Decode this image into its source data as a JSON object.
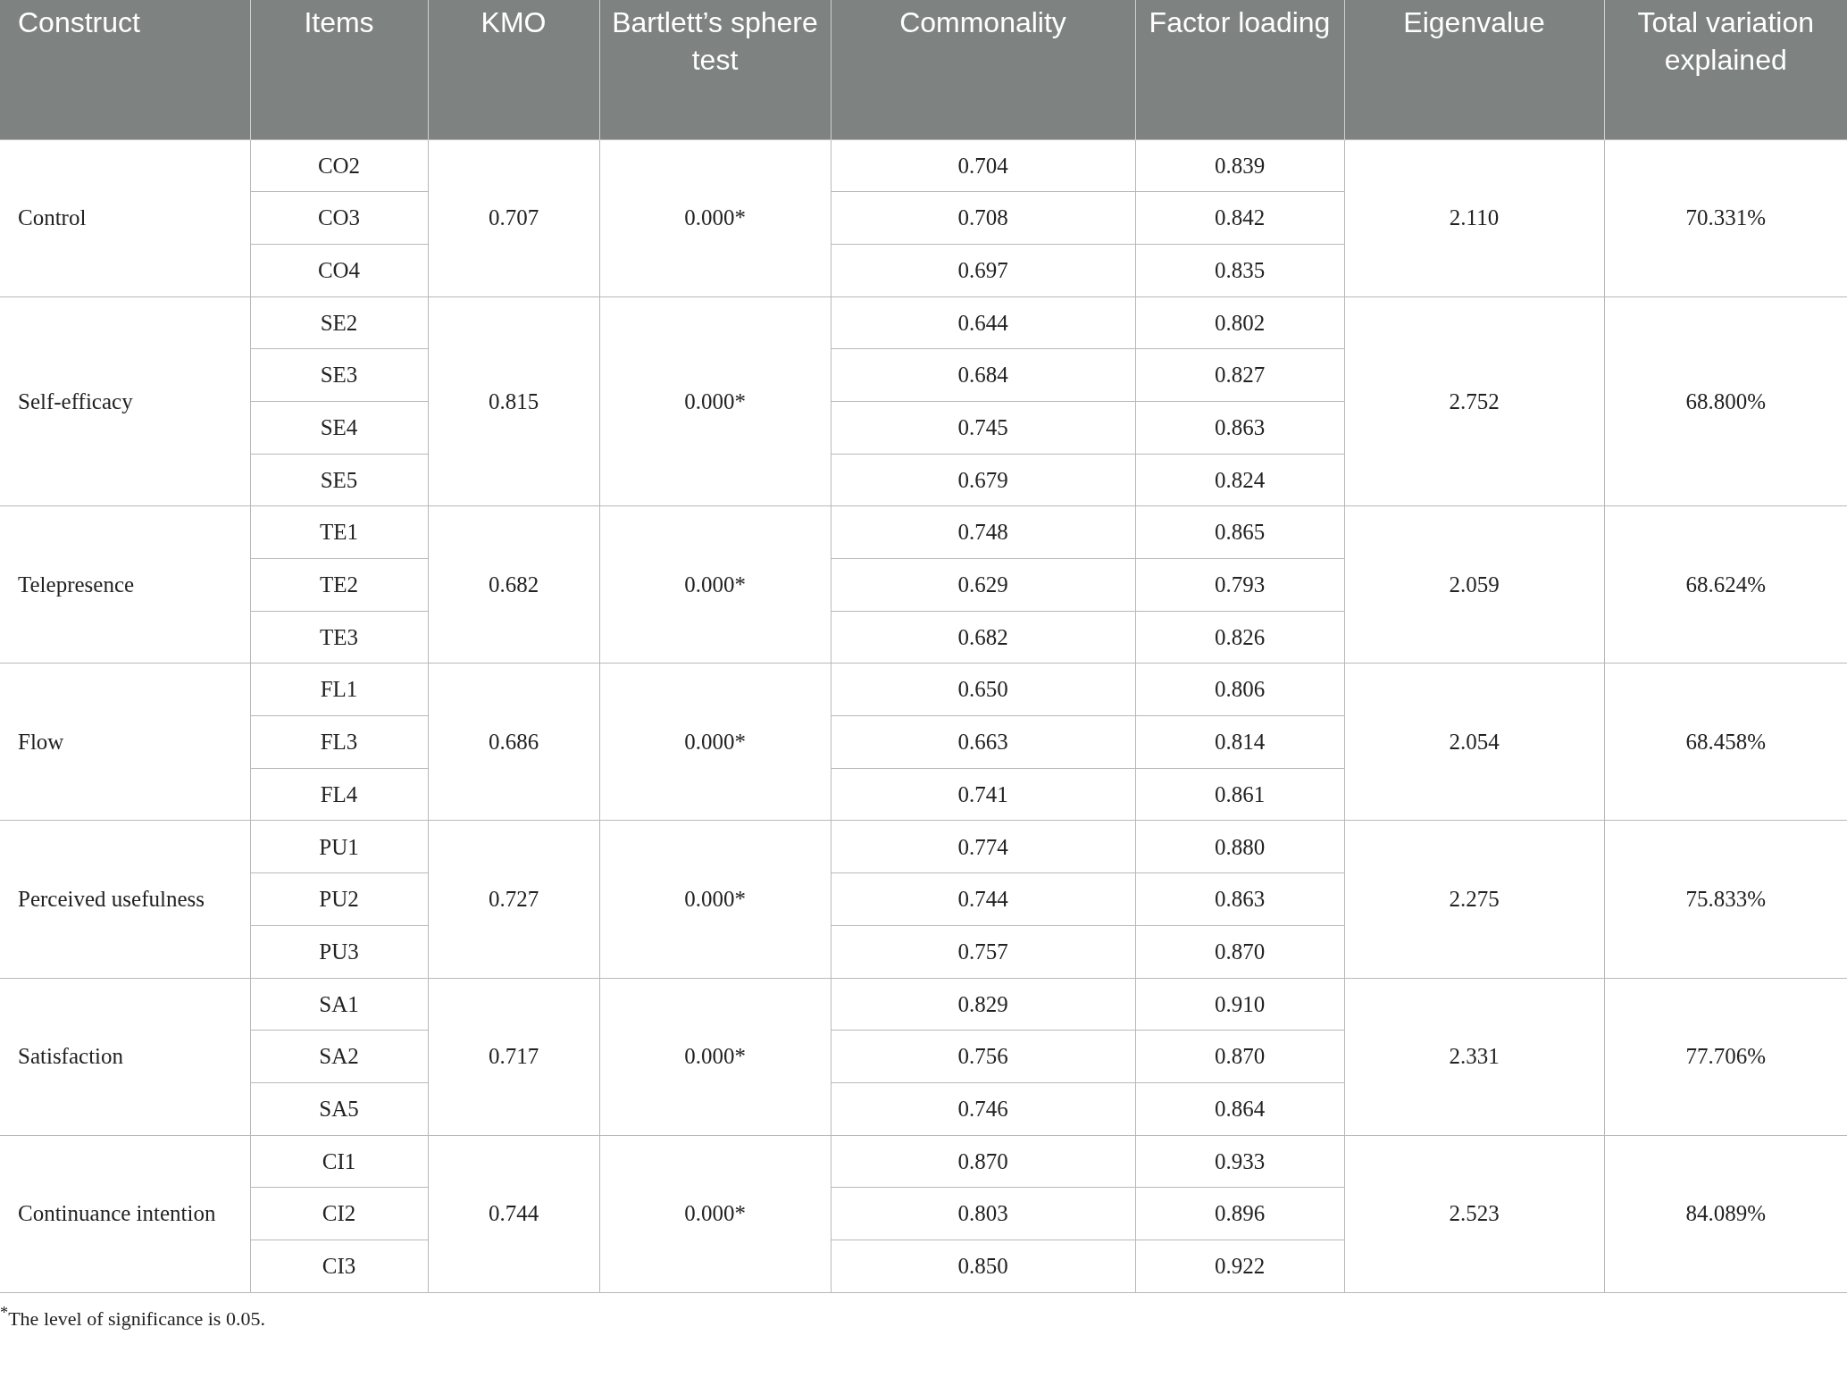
{
  "table": {
    "columns": [
      "Construct",
      "Items",
      "KMO",
      "Bartlett’s sphere test",
      "Commonality",
      "Factor loading",
      "Eigenvalue",
      "Total variation explained"
    ],
    "groups": [
      {
        "construct": "Control",
        "kmo": "0.707",
        "bartlett": "0.000*",
        "eigenvalue": "2.110",
        "total_variation": "70.331%",
        "items": [
          {
            "item": "CO2",
            "commonality": "0.704",
            "factor_loading": "0.839"
          },
          {
            "item": "CO3",
            "commonality": "0.708",
            "factor_loading": "0.842"
          },
          {
            "item": "CO4",
            "commonality": "0.697",
            "factor_loading": "0.835"
          }
        ]
      },
      {
        "construct": "Self-efficacy",
        "kmo": "0.815",
        "bartlett": "0.000*",
        "eigenvalue": "2.752",
        "total_variation": "68.800%",
        "items": [
          {
            "item": "SE2",
            "commonality": "0.644",
            "factor_loading": "0.802"
          },
          {
            "item": "SE3",
            "commonality": "0.684",
            "factor_loading": "0.827"
          },
          {
            "item": "SE4",
            "commonality": "0.745",
            "factor_loading": "0.863"
          },
          {
            "item": "SE5",
            "commonality": "0.679",
            "factor_loading": "0.824"
          }
        ]
      },
      {
        "construct": "Telepresence",
        "kmo": "0.682",
        "bartlett": "0.000*",
        "eigenvalue": "2.059",
        "total_variation": "68.624%",
        "items": [
          {
            "item": "TE1",
            "commonality": "0.748",
            "factor_loading": "0.865"
          },
          {
            "item": "TE2",
            "commonality": "0.629",
            "factor_loading": "0.793"
          },
          {
            "item": "TE3",
            "commonality": "0.682",
            "factor_loading": "0.826"
          }
        ]
      },
      {
        "construct": "Flow",
        "kmo": "0.686",
        "bartlett": "0.000*",
        "eigenvalue": "2.054",
        "total_variation": "68.458%",
        "items": [
          {
            "item": "FL1",
            "commonality": "0.650",
            "factor_loading": "0.806"
          },
          {
            "item": "FL3",
            "commonality": "0.663",
            "factor_loading": "0.814"
          },
          {
            "item": "FL4",
            "commonality": "0.741",
            "factor_loading": "0.861"
          }
        ]
      },
      {
        "construct": "Perceived usefulness",
        "kmo": "0.727",
        "bartlett": "0.000*",
        "eigenvalue": "2.275",
        "total_variation": "75.833%",
        "items": [
          {
            "item": "PU1",
            "commonality": "0.774",
            "factor_loading": "0.880"
          },
          {
            "item": "PU2",
            "commonality": "0.744",
            "factor_loading": "0.863"
          },
          {
            "item": "PU3",
            "commonality": "0.757",
            "factor_loading": "0.870"
          }
        ]
      },
      {
        "construct": "Satisfaction",
        "kmo": "0.717",
        "bartlett": "0.000*",
        "eigenvalue": "2.331",
        "total_variation": "77.706%",
        "items": [
          {
            "item": "SA1",
            "commonality": "0.829",
            "factor_loading": "0.910"
          },
          {
            "item": "SA2",
            "commonality": "0.756",
            "factor_loading": "0.870"
          },
          {
            "item": "SA5",
            "commonality": "0.746",
            "factor_loading": "0.864"
          }
        ]
      },
      {
        "construct": "Continuance intention",
        "kmo": "0.744",
        "bartlett": "0.000*",
        "eigenvalue": "2.523",
        "total_variation": "84.089%",
        "items": [
          {
            "item": "CI1",
            "commonality": "0.870",
            "factor_loading": "0.933"
          },
          {
            "item": "CI2",
            "commonality": "0.803",
            "factor_loading": "0.896"
          },
          {
            "item": "CI3",
            "commonality": "0.850",
            "factor_loading": "0.922"
          }
        ]
      }
    ]
  },
  "footnote": "$^{*}$The level of significance is 0.05."
}
